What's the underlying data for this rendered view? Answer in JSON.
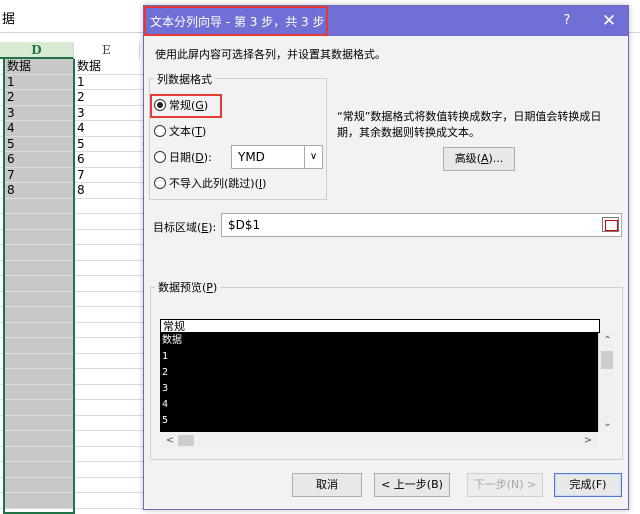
{
  "sheet": {
    "formula_text": "据",
    "col_d": "D",
    "col_e": "E",
    "rows": [
      {
        "d": "数据",
        "e": "数据"
      },
      {
        "d": "1",
        "e": "1"
      },
      {
        "d": "2",
        "e": "2"
      },
      {
        "d": "3",
        "e": "3"
      },
      {
        "d": "4",
        "e": "4"
      },
      {
        "d": "5",
        "e": "5"
      },
      {
        "d": "6",
        "e": "6"
      },
      {
        "d": "7",
        "e": "7"
      },
      {
        "d": "8",
        "e": "8"
      }
    ]
  },
  "dialog": {
    "title": "文本分列向导 - 第 3 步，共 3 步",
    "help": "?",
    "close": "✕",
    "instruction": "使用此屏内容可选择各列，并设置其数据格式。",
    "format_group": {
      "legend": "列数据格式",
      "general": {
        "label": "常规",
        "key": "G",
        "checked": true
      },
      "text": {
        "label": "文本",
        "key": "T",
        "checked": false
      },
      "date": {
        "label": "日期",
        "key": "D",
        "checked": false,
        "value": "YMD"
      },
      "skip": {
        "label": "不导入此列(跳过)",
        "key": "I",
        "checked": false
      }
    },
    "description": "“常规”数据格式将数值转换成数字，日期值会转换成日期，其余数据则转换成文本。",
    "advanced": {
      "label": "高级",
      "key": "A"
    },
    "destination": {
      "label": "目标区域",
      "key": "E",
      "value": "$D$1"
    },
    "preview": {
      "legend": "数据预览",
      "key": "P",
      "header": "常规",
      "lines": [
        "数据",
        "1",
        "2",
        "3",
        "4",
        "5"
      ]
    },
    "buttons": {
      "cancel": "取消",
      "back": "< 上一步(B)",
      "next": "下一步(N) >",
      "finish": "完成(F)"
    }
  },
  "colors": {
    "title_bar": "#6f6fd6",
    "highlight": "#e53935",
    "selection": "#217346"
  }
}
